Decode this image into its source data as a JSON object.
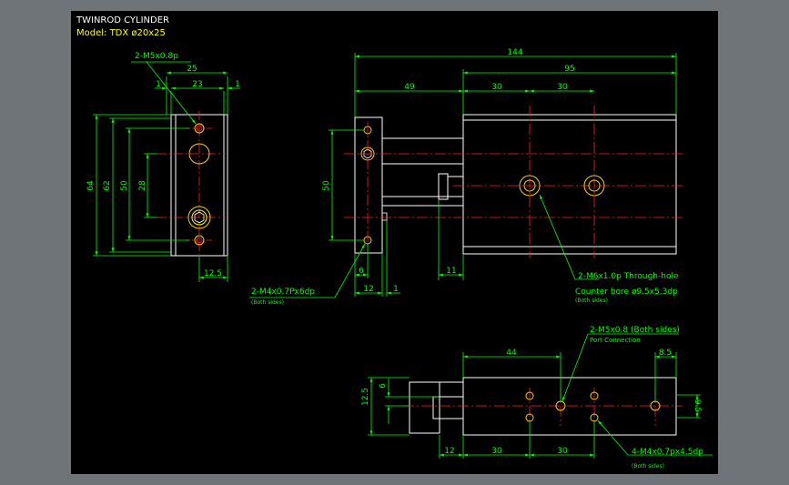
{
  "title": {
    "line1": "TWINROD CYLINDER",
    "line2": "Model: TDX  ø20x25"
  },
  "colors": {
    "background": "#6f7479",
    "sheet": "#000000",
    "dimension": "#00ff00",
    "note": "#ffff00",
    "outline": "#ffffff",
    "hole": "#ffcc00",
    "centerline": "#ff2020"
  },
  "end_view": {
    "callout_thread": "2-M5x0.8p",
    "dim_width": "25",
    "dim_inner": "23",
    "dim_gap_left": "1",
    "dim_gap_right": "1",
    "dim_height_total": "64",
    "dim_height_62": "62",
    "dim_height_50": "50",
    "dim_height_28": "28",
    "dim_bottom": "12.5"
  },
  "side_view": {
    "dim_overall": "144",
    "dim_body": "95",
    "dim_rod": "49",
    "dim_pitch_a": "30",
    "dim_pitch_b": "30",
    "dim_height_50": "50",
    "dim_6": "6",
    "dim_11": "11",
    "dim_12": "12",
    "dim_1": "1",
    "callout_plate_thread": "2-M4x0.7Px6dp",
    "callout_plate_note": "(Both sides)",
    "callout_body_thread": "2-M6x1.0p Through-hole",
    "callout_body_bore": "Counter bore ø9.5x5.3dp",
    "callout_body_note": "(Both sides)"
  },
  "top_view": {
    "callout_port": "2-M5x0.8 (Both sides)",
    "callout_port_note": "Port Connection",
    "dim_44": "44",
    "dim_8_5": "8.5",
    "dim_12_5": "12.5",
    "dim_6": "6",
    "dim_9_5": "9.5",
    "dim_12": "12",
    "dim_30a": "30",
    "dim_30b": "30",
    "callout_bottom_thread": "4-M4x0.7px4.5dp",
    "callout_bottom_note": "(Both sides)"
  }
}
